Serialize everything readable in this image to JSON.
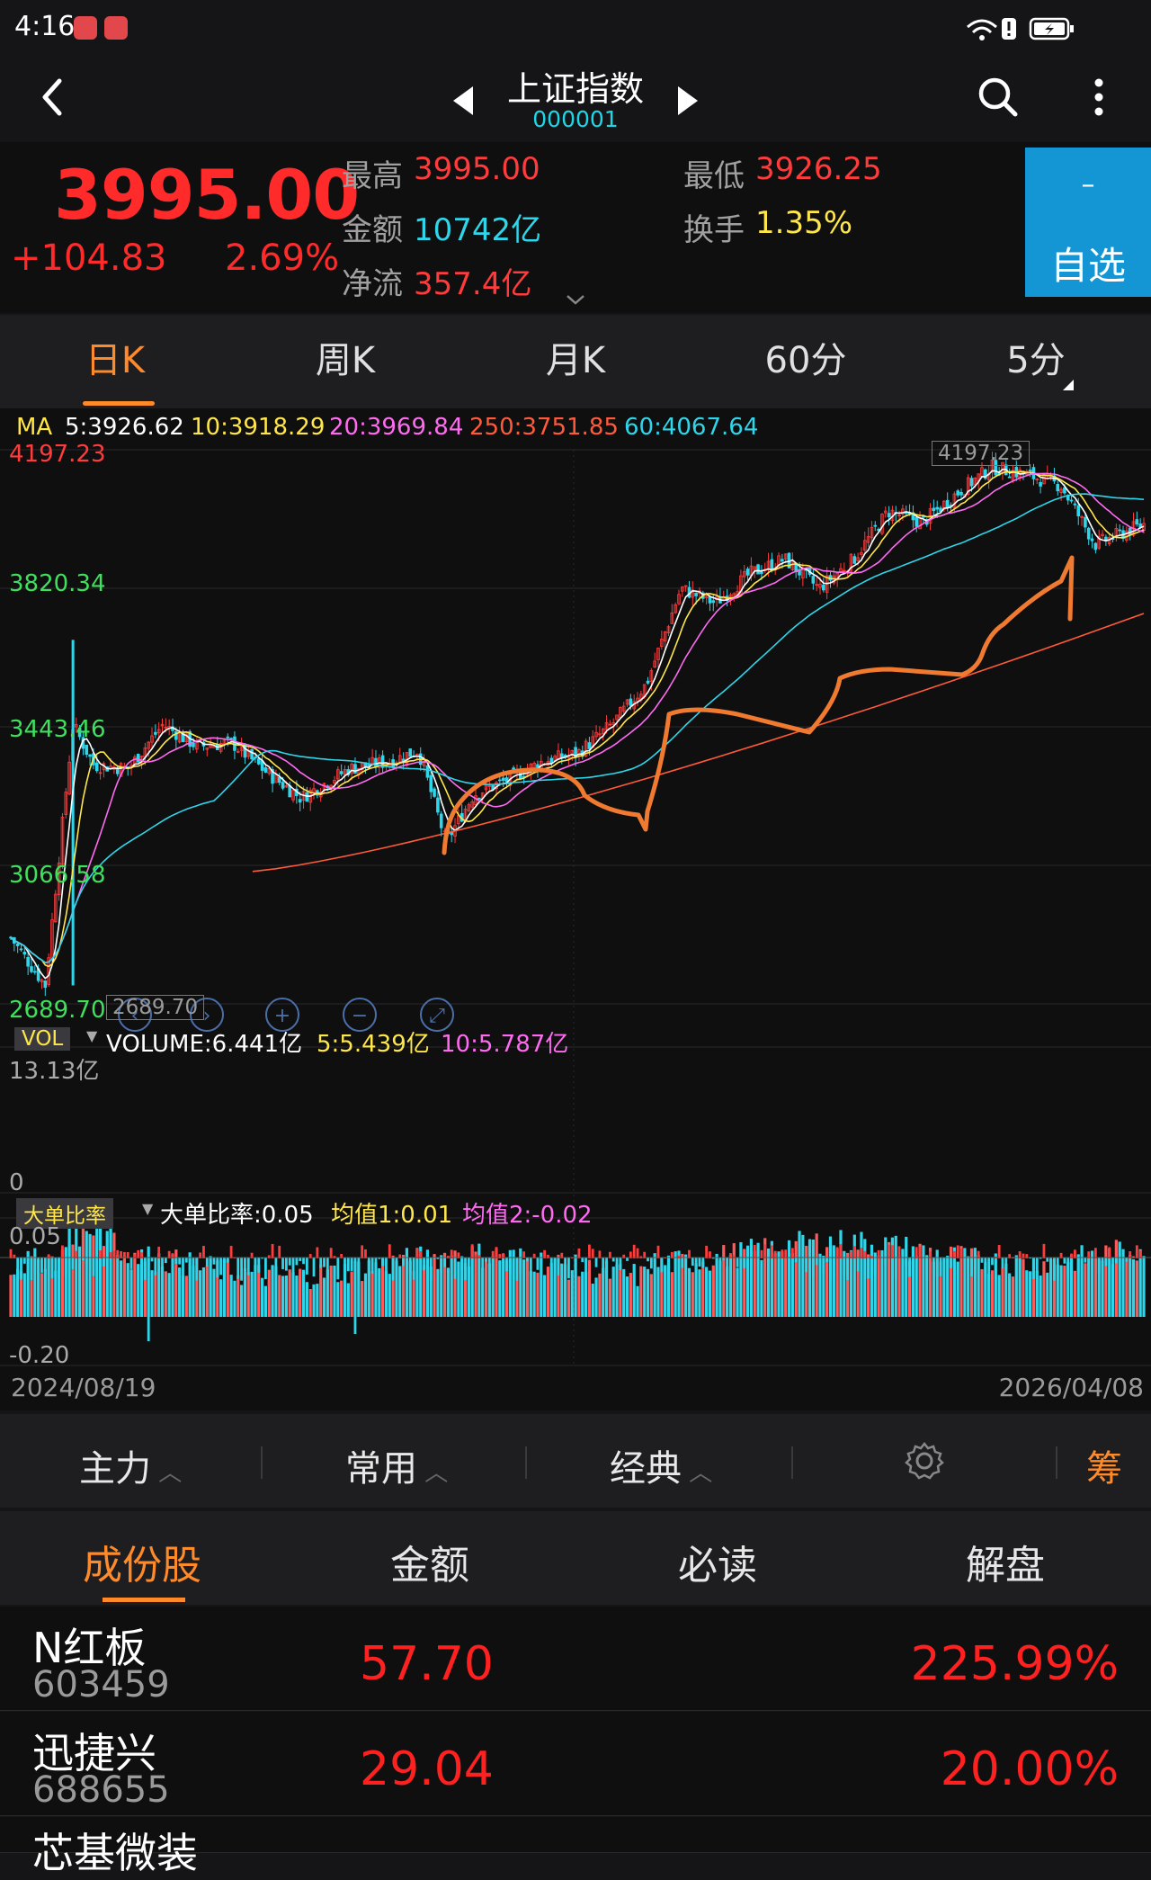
{
  "status_bar": {
    "time": "4:16"
  },
  "header": {
    "title": "上证指数",
    "code": "000001"
  },
  "quote": {
    "price": "3995.00",
    "change": "+104.83",
    "change_pct": "2.69%",
    "high_label": "最高",
    "high": "3995.00",
    "low_label": "最低",
    "low": "3926.25",
    "amount_label": "金额",
    "amount": "10742亿",
    "turnover_label": "换手",
    "turnover": "1.35%",
    "netflow_label": "净流",
    "netflow": "357.4亿",
    "fav_minus": "–",
    "fav_label": "自选"
  },
  "period_tabs": [
    "日K",
    "周K",
    "月K",
    "60分",
    "5分"
  ],
  "period_active": 0,
  "ma_legend": {
    "ma": "MA",
    "ma5": "5:3926.62",
    "ma10": "10:3918.29",
    "ma20": "20:3969.84",
    "ma250": "250:3751.85",
    "ma60": "60:4067.64"
  },
  "price_axis": {
    "top": "4197.23",
    "l1": "3820.34",
    "l2": "3443.46",
    "l3": "3066.58",
    "bottom": "2689.70",
    "max_marker": "4197.23",
    "min_marker": "2689.70"
  },
  "volume": {
    "tag": "VOL",
    "label": "VOLUME:6.441亿",
    "ma5": "5:5.439亿",
    "ma10": "10:5.787亿",
    "max": "13.13亿",
    "min": "0"
  },
  "big_order": {
    "tag": "大单比率",
    "label": "大单比率:0.05",
    "avg1": "均值1:0.01",
    "avg2": "均值2:-0.02",
    "max": "0.05",
    "min": "-0.20"
  },
  "dates": {
    "start": "2024/08/19",
    "end": "2026/04/08"
  },
  "toolbar": {
    "main": "主力",
    "common": "常用",
    "classic": "经典",
    "chip": "筹"
  },
  "content_tabs": [
    "成份股",
    "金额",
    "必读",
    "解盘"
  ],
  "stocks": [
    {
      "name": "N红板",
      "code": "603459",
      "amount": "57.70",
      "change": "225.99%"
    },
    {
      "name": "迅捷兴",
      "code": "688655",
      "amount": "29.04",
      "change": "20.00%"
    },
    {
      "name": "芯基微装",
      "code": "",
      "amount": "",
      "change": ""
    }
  ],
  "colors": {
    "up": "#ff3b3b",
    "down": "#2fd6ea",
    "accent": "#ff8a2a",
    "ma5": "#ffffff",
    "ma10": "#ffe64a",
    "ma20": "#ff6bf0",
    "ma60": "#2fd6ea",
    "ma250": "#ff5a3a"
  },
  "chart_data": {
    "type": "candlestick",
    "x_range": [
      "2024/08/19",
      "2026/04/08"
    ],
    "ylim": [
      2689.7,
      4197.23
    ],
    "yticks": [
      4197.23,
      3820.34,
      3443.46,
      3066.58,
      2689.7
    ],
    "close_path": [
      [
        2024.63,
        2870
      ],
      [
        2024.68,
        2740
      ],
      [
        2024.72,
        3450
      ],
      [
        2024.75,
        3340
      ],
      [
        2024.8,
        3330
      ],
      [
        2024.85,
        3450
      ],
      [
        2024.9,
        3390
      ],
      [
        2024.95,
        3400
      ],
      [
        2025.0,
        3320
      ],
      [
        2025.05,
        3250
      ],
      [
        2025.12,
        3330
      ],
      [
        2025.18,
        3350
      ],
      [
        2025.22,
        3380
      ],
      [
        2025.26,
        3130
      ],
      [
        2025.3,
        3260
      ],
      [
        2025.35,
        3300
      ],
      [
        2025.4,
        3350
      ],
      [
        2025.45,
        3370
      ],
      [
        2025.5,
        3450
      ],
      [
        2025.55,
        3560
      ],
      [
        2025.6,
        3820
      ],
      [
        2025.65,
        3780
      ],
      [
        2025.7,
        3860
      ],
      [
        2025.75,
        3900
      ],
      [
        2025.8,
        3820
      ],
      [
        2025.85,
        3900
      ],
      [
        2025.9,
        4030
      ],
      [
        2025.95,
        4000
      ],
      [
        2026.0,
        4080
      ],
      [
        2026.05,
        4150
      ],
      [
        2026.1,
        4130
      ],
      [
        2026.15,
        4100
      ],
      [
        2026.2,
        3940
      ],
      [
        2026.27,
        3995
      ]
    ]
  }
}
